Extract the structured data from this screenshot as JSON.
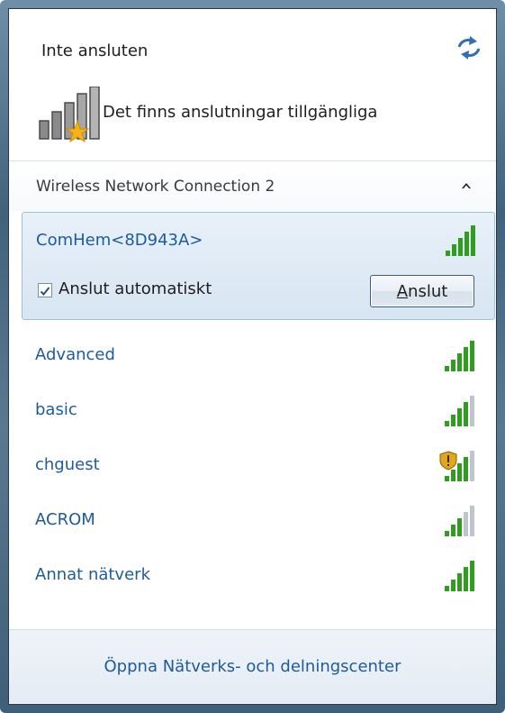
{
  "status": {
    "title": "Inte ansluten",
    "available_text": "Det finns anslutningar tillgängliga"
  },
  "section": {
    "title": "Wireless Network Connection 2"
  },
  "selected_network": {
    "name": "ComHem<8D943A>",
    "auto_connect_label": "Anslut automatiskt",
    "auto_connect_checked": true,
    "connect_button_label": "Anslut",
    "signal_bars": 5
  },
  "networks": [
    {
      "name": "Advanced",
      "signal_bars": 5,
      "secured_warning": false
    },
    {
      "name": "basic",
      "signal_bars": 4,
      "secured_warning": false
    },
    {
      "name": "chguest",
      "signal_bars": 4,
      "secured_warning": true
    },
    {
      "name": "ACROM",
      "signal_bars": 3,
      "secured_warning": false
    },
    {
      "name": "Annat nätverk",
      "signal_bars": 5,
      "secured_warning": false
    }
  ],
  "footer": {
    "link": "Öppna Nätverks- och delningscenter"
  },
  "colors": {
    "link_blue": "#1d5b9c",
    "signal_green": "#2f9e1f",
    "signal_gray": "#bfc5cc",
    "warning_gold": "#e0a818"
  },
  "icons": {
    "refresh": "refresh-icon",
    "collapse": "chevron-up-icon",
    "signal": "signal-strength-icon",
    "shield": "shield-warning-icon"
  }
}
